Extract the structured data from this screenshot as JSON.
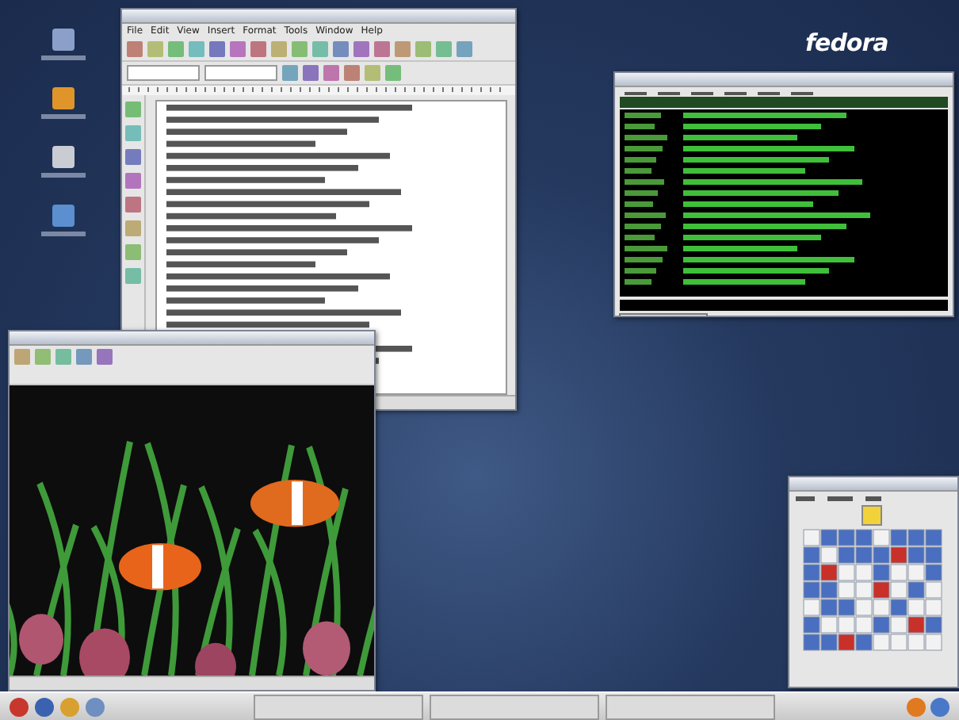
{
  "logo": "fedora",
  "writer": {
    "menu": [
      "File",
      "Edit",
      "View",
      "Insert",
      "Format",
      "Tools",
      "Window",
      "Help"
    ]
  }
}
